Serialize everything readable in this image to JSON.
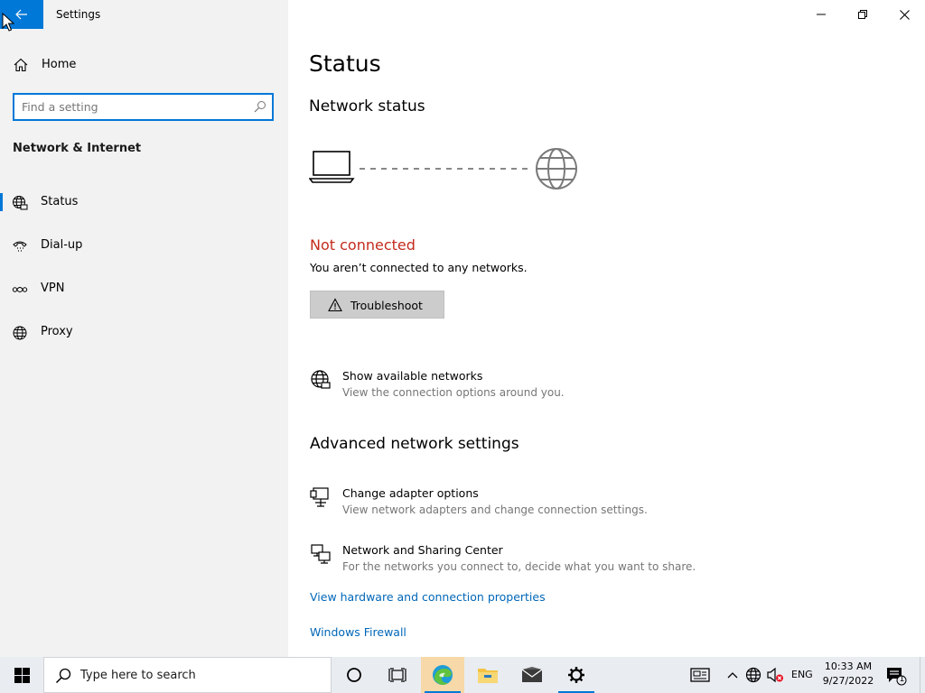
{
  "window": {
    "app_title": "Settings"
  },
  "sidebar": {
    "home_label": "Home",
    "search_placeholder": "Find a setting",
    "section_title": "Network & Internet",
    "items": [
      {
        "label": "Status",
        "icon": "status-globe-icon",
        "selected": true
      },
      {
        "label": "Dial-up",
        "icon": "dialup-phone-icon",
        "selected": false
      },
      {
        "label": "VPN",
        "icon": "vpn-icon",
        "selected": false
      },
      {
        "label": "Proxy",
        "icon": "globe-icon",
        "selected": false
      }
    ]
  },
  "main": {
    "page_title": "Status",
    "network_status_heading": "Network status",
    "status_text": "Not connected",
    "status_desc": "You aren’t connected to any networks.",
    "troubleshoot_label": "Troubleshoot",
    "show_networks": {
      "title": "Show available networks",
      "desc": "View the connection options around you."
    },
    "advanced_heading": "Advanced network settings",
    "change_adapter": {
      "title": "Change adapter options",
      "desc": "View network adapters and change connection settings."
    },
    "sharing_center": {
      "title": "Network and Sharing Center",
      "desc": "For the networks you connect to, decide what you want to share."
    },
    "links": {
      "hardware": "View hardware and connection properties",
      "firewall": "Windows Firewall"
    }
  },
  "taskbar": {
    "search_text": "Type here to search",
    "language": "ENG",
    "time": "10:33 AM",
    "date": "9/27/2022",
    "notification_count": "1"
  },
  "colors": {
    "accent": "#0078d7",
    "error": "#c42b1c",
    "link": "#0067b8",
    "sidebar_bg": "#f2f2f2"
  }
}
